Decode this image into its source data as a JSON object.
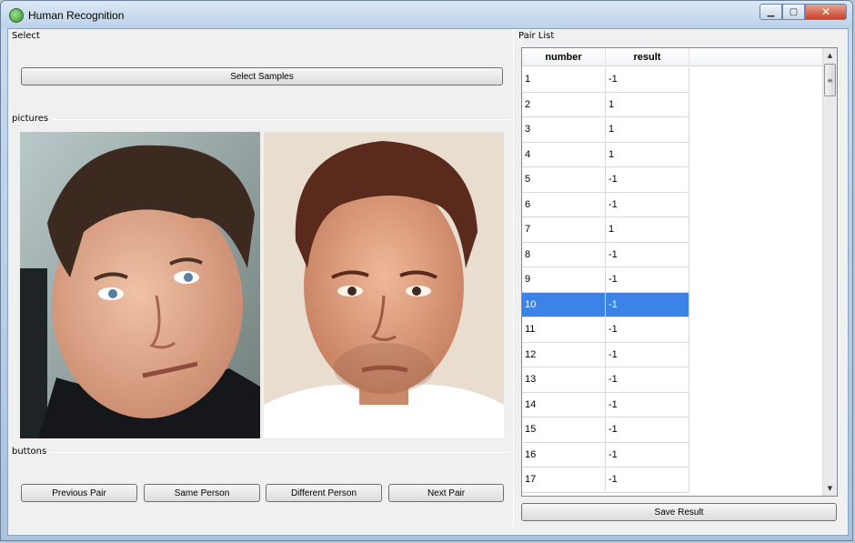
{
  "window": {
    "title": "Human Recognition",
    "controls": {
      "minimize": "▁",
      "maximize": "▢",
      "close": "✕"
    }
  },
  "select_group": {
    "label": "Select",
    "select_samples_button": "Select Samples"
  },
  "pictures_group": {
    "label": "pictures",
    "left_photo": "face-photo-left",
    "right_photo": "face-photo-right"
  },
  "buttons_group": {
    "label": "buttons",
    "previous_pair": "Previous Pair",
    "same_person": "Same Person",
    "different_person": "Different Person",
    "next_pair": "Next Pair"
  },
  "pair_list": {
    "label": "Pair List",
    "columns": [
      "number",
      "result"
    ],
    "selected_index": 9,
    "rows": [
      {
        "number": "1",
        "result": "-1"
      },
      {
        "number": "2",
        "result": "1"
      },
      {
        "number": "3",
        "result": "1"
      },
      {
        "number": "4",
        "result": "1"
      },
      {
        "number": "5",
        "result": "-1"
      },
      {
        "number": "6",
        "result": "-1"
      },
      {
        "number": "7",
        "result": "1"
      },
      {
        "number": "8",
        "result": "-1"
      },
      {
        "number": "9",
        "result": "-1"
      },
      {
        "number": "10",
        "result": "-1"
      },
      {
        "number": "11",
        "result": "-1"
      },
      {
        "number": "12",
        "result": "-1"
      },
      {
        "number": "13",
        "result": "-1"
      },
      {
        "number": "14",
        "result": "-1"
      },
      {
        "number": "15",
        "result": "-1"
      },
      {
        "number": "16",
        "result": "-1"
      },
      {
        "number": "17",
        "result": "-1"
      }
    ],
    "save_result_button": "Save Result",
    "scrollbar": {
      "up_arrow": "▲",
      "down_arrow": "▼",
      "thumb_grip": "≡"
    }
  },
  "colors": {
    "selection": "#3b83e6",
    "panel_bg": "#f0f0f0"
  }
}
